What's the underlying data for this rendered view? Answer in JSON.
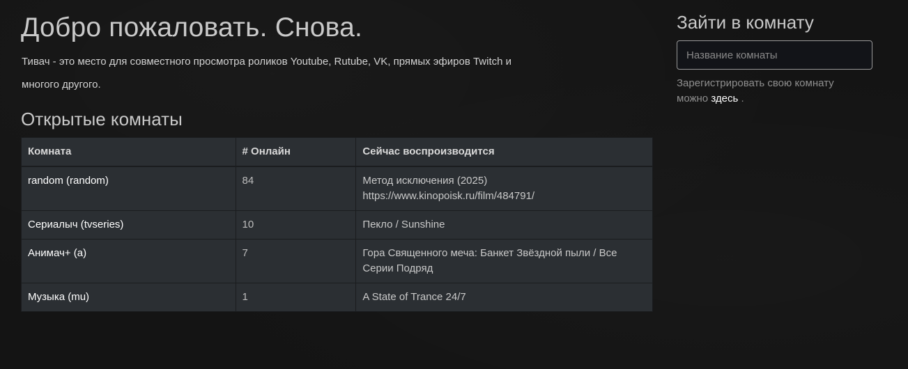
{
  "header": {
    "title": "Добро пожаловать. Снова.",
    "intro": "Тивач - это место для совместного просмотра роликов Youtube, Rutube, VK, прямых эфиров Twitch и многого другого."
  },
  "rooms": {
    "section_title": "Открытые комнаты",
    "columns": [
      "Комната",
      "# Онлайн",
      "Сейчас воспроизводится"
    ],
    "rows": [
      {
        "room": "random (random)",
        "online": "84",
        "playing_line1": "Метод исключения (2025)",
        "playing_line2": "https://www.kinopoisk.ru/film/484791/"
      },
      {
        "room": "Сериалыч (tvseries)",
        "online": "10",
        "playing_line1": "Пекло / Sunshine",
        "playing_line2": ""
      },
      {
        "room": "Анимач+ (a)",
        "online": "7",
        "playing_line1": "Гора Священного меча: Банкет Звёздной пыли / Все Серии Подряд",
        "playing_line2": ""
      },
      {
        "room": "Музыка (mu)",
        "online": "1",
        "playing_line1": "A State of Trance 24/7",
        "playing_line2": ""
      }
    ]
  },
  "join": {
    "title": "Зайти в комнату",
    "placeholder": "Название комнаты",
    "register_text": "Зарегистрировать свою комнату можно",
    "register_link": "здесь",
    "register_suffix": "."
  },
  "colors": {
    "background": "#141414",
    "table_bg": "#2b2f33",
    "link": "#ffffff"
  }
}
